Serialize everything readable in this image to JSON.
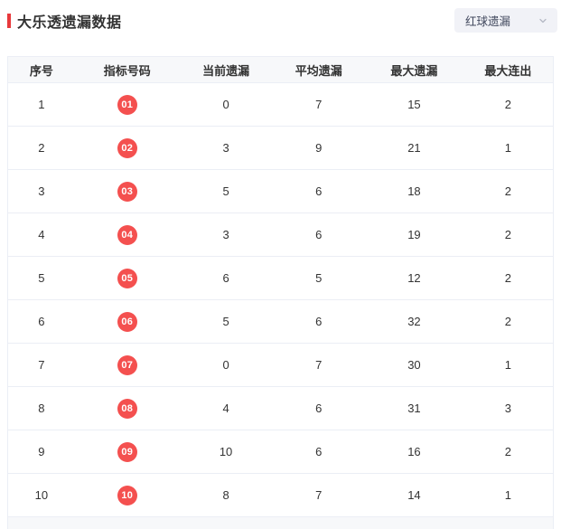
{
  "page": {
    "title": "大乐透遗漏数据"
  },
  "filter": {
    "selected_option": "红球遗漏",
    "chevron_icon": "chevron-down"
  },
  "table": {
    "columns": [
      "序号",
      "指标号码",
      "当前遗漏",
      "平均遗漏",
      "最大遗漏",
      "最大连出"
    ],
    "rows": [
      {
        "no": "1",
        "ball": "01",
        "current": "0",
        "avg": "7",
        "max": "15",
        "streak": "2"
      },
      {
        "no": "2",
        "ball": "02",
        "current": "3",
        "avg": "9",
        "max": "21",
        "streak": "1"
      },
      {
        "no": "3",
        "ball": "03",
        "current": "5",
        "avg": "6",
        "max": "18",
        "streak": "2"
      },
      {
        "no": "4",
        "ball": "04",
        "current": "3",
        "avg": "6",
        "max": "19",
        "streak": "2"
      },
      {
        "no": "5",
        "ball": "05",
        "current": "6",
        "avg": "5",
        "max": "12",
        "streak": "2"
      },
      {
        "no": "6",
        "ball": "06",
        "current": "5",
        "avg": "6",
        "max": "32",
        "streak": "2"
      },
      {
        "no": "7",
        "ball": "07",
        "current": "0",
        "avg": "7",
        "max": "30",
        "streak": "1"
      },
      {
        "no": "8",
        "ball": "08",
        "current": "4",
        "avg": "6",
        "max": "31",
        "streak": "3"
      },
      {
        "no": "9",
        "ball": "09",
        "current": "10",
        "avg": "6",
        "max": "16",
        "streak": "2"
      },
      {
        "no": "10",
        "ball": "10",
        "current": "8",
        "avg": "7",
        "max": "14",
        "streak": "1"
      }
    ]
  },
  "colors": {
    "accent_red": "#f4504f",
    "title_bar_red": "#e8393c",
    "header_bg": "#f7f8fa",
    "border": "#ebeef5",
    "text": "#333333",
    "select_bg": "#f1f2f7",
    "select_text": "#41485d"
  }
}
